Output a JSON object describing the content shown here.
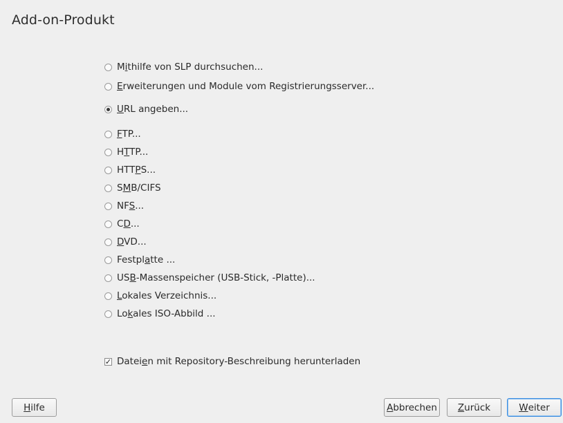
{
  "window": {
    "title": "Add-on-Produkt"
  },
  "options": [
    {
      "label_pre": "M",
      "label_ul": "i",
      "label_post": "thilfe von SLP durchsuchen...",
      "checked": false
    },
    {
      "label_pre": "",
      "label_ul": "E",
      "label_post": "rweiterungen und Module vom Registrierungsserver...",
      "checked": false
    },
    {
      "label_pre": "",
      "label_ul": "U",
      "label_post": "RL angeben...",
      "checked": true
    },
    {
      "label_pre": "",
      "label_ul": "F",
      "label_post": "TP...",
      "checked": false
    },
    {
      "label_pre": "H",
      "label_ul": "T",
      "label_post": "TP...",
      "checked": false
    },
    {
      "label_pre": "HTT",
      "label_ul": "P",
      "label_post": "S...",
      "checked": false
    },
    {
      "label_pre": "S",
      "label_ul": "M",
      "label_post": "B/CIFS",
      "checked": false
    },
    {
      "label_pre": "NF",
      "label_ul": "S",
      "label_post": "...",
      "checked": false
    },
    {
      "label_pre": "C",
      "label_ul": "D",
      "label_post": "...",
      "checked": false
    },
    {
      "label_pre": "",
      "label_ul": "D",
      "label_post": "VD...",
      "checked": false
    },
    {
      "label_pre": "Festpl",
      "label_ul": "a",
      "label_post": "tte ...",
      "checked": false
    },
    {
      "label_pre": "US",
      "label_ul": "B",
      "label_post": "-Massenspeicher (USB-Stick, -Platte)...",
      "checked": false
    },
    {
      "label_pre": "",
      "label_ul": "L",
      "label_post": "okales Verzeichnis...",
      "checked": false
    },
    {
      "label_pre": "Lo",
      "label_ul": "k",
      "label_post": "ales ISO-Abbild ...",
      "checked": false
    }
  ],
  "download_checkbox": {
    "label_pre": "Datei",
    "label_ul": "e",
    "label_post": "n mit Repository-Beschreibung herunterladen",
    "checked": true,
    "check_mark": "✓"
  },
  "buttons": {
    "help": {
      "pre": "",
      "ul": "H",
      "post": "ilfe"
    },
    "cancel": {
      "pre": "",
      "ul": "A",
      "post": "bbrechen"
    },
    "back": {
      "pre": "",
      "ul": "Z",
      "post": "urück"
    },
    "next": {
      "pre": "",
      "ul": "W",
      "post": "eiter"
    }
  },
  "colors": {
    "background": "#efefef",
    "default_button_border": "#3d8ee0"
  }
}
